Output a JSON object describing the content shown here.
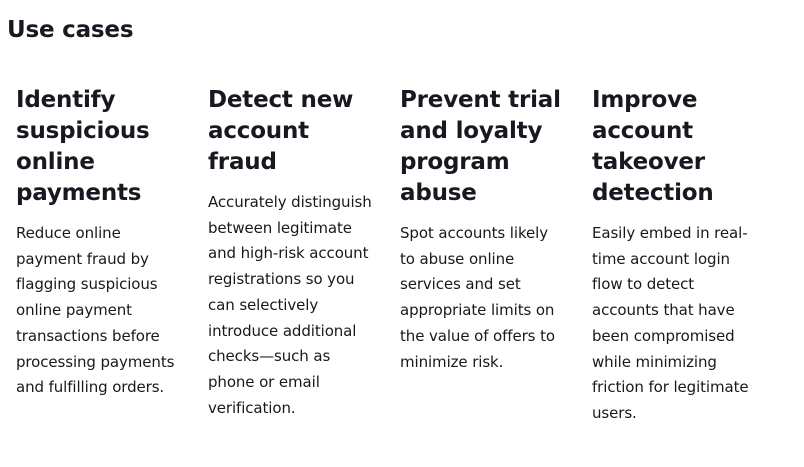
{
  "section": {
    "title": "Use cases"
  },
  "cards": [
    {
      "title": "Identify suspicious online payments",
      "text": "Reduce online payment fraud by flagging suspicious online payment transactions before processing payments and fulfilling orders."
    },
    {
      "title": "Detect new account fraud",
      "text": "Accurately distinguish between legitimate and high-risk account registrations so you can selectively introduce additional checks—such as phone or email verification."
    },
    {
      "title": "Prevent trial and loyalty program abuse",
      "text": "Spot accounts likely to abuse online services and set appropriate limits on the value of offers to minimize risk."
    },
    {
      "title": "Improve account takeover detection",
      "text": "Easily embed in real-time account login flow to detect accounts that have been compromised while minimizing friction for legitimate users."
    }
  ]
}
